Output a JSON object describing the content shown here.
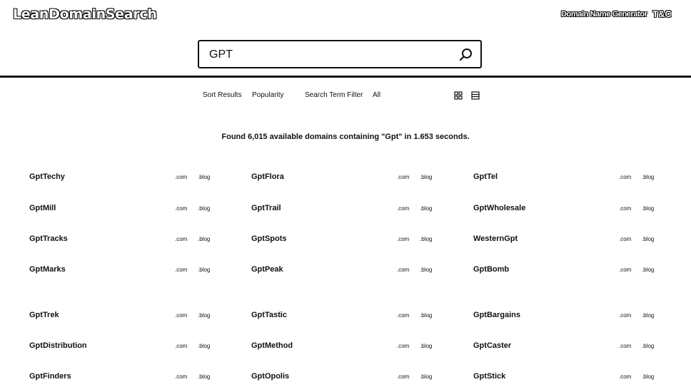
{
  "header": {
    "logo": "LeanDomainSearch",
    "generator_link": "Domain Name Generator",
    "icon_label": "T&C"
  },
  "search": {
    "value": "GPT",
    "placeholder": ""
  },
  "controls": {
    "sort_label": "Sort Results",
    "sort_value": "Popularity",
    "filter_label": "Search Term Filter",
    "filter_value": "All"
  },
  "found_text": "Found 6,015 available domains containing \"Gpt\" in 1.653 seconds.",
  "tld_labels": [
    ".com",
    ".blog"
  ],
  "results": [
    [
      "GptTechy",
      "GptFlora",
      "GptTel"
    ],
    [
      "GptMill",
      "GptTrail",
      "GptWholesale"
    ],
    [
      "GptTracks",
      "GptSpots",
      "WesternGpt"
    ],
    [
      "GptMarks",
      "GptPeak",
      "GptBomb"
    ],
    [
      "GptTrek",
      "GptTastic",
      "GptBargains"
    ],
    [
      "GptDistribution",
      "GptMethod",
      "GptCaster"
    ],
    [
      "GptFinders",
      "GptOpolis",
      "GptStick"
    ]
  ]
}
